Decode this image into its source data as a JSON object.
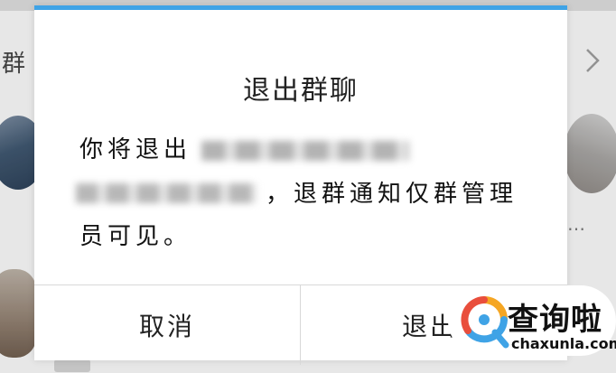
{
  "background": {
    "title_fragment": "群",
    "ellipsis": "…"
  },
  "dialog": {
    "title": "退出群聊",
    "message_line1_prefix": "你将退出",
    "message_line2_suffix": "，退群通知仅群管理",
    "message_line3": "员可见。",
    "cancel_label": "取消",
    "exit_label": "退出",
    "accent_color": "#3fa3e6"
  },
  "watermark": {
    "name": "查询啦",
    "domain": "chaxunla.com",
    "colors": [
      "#f5a623",
      "#3fa3e6",
      "#e94e3c"
    ]
  }
}
